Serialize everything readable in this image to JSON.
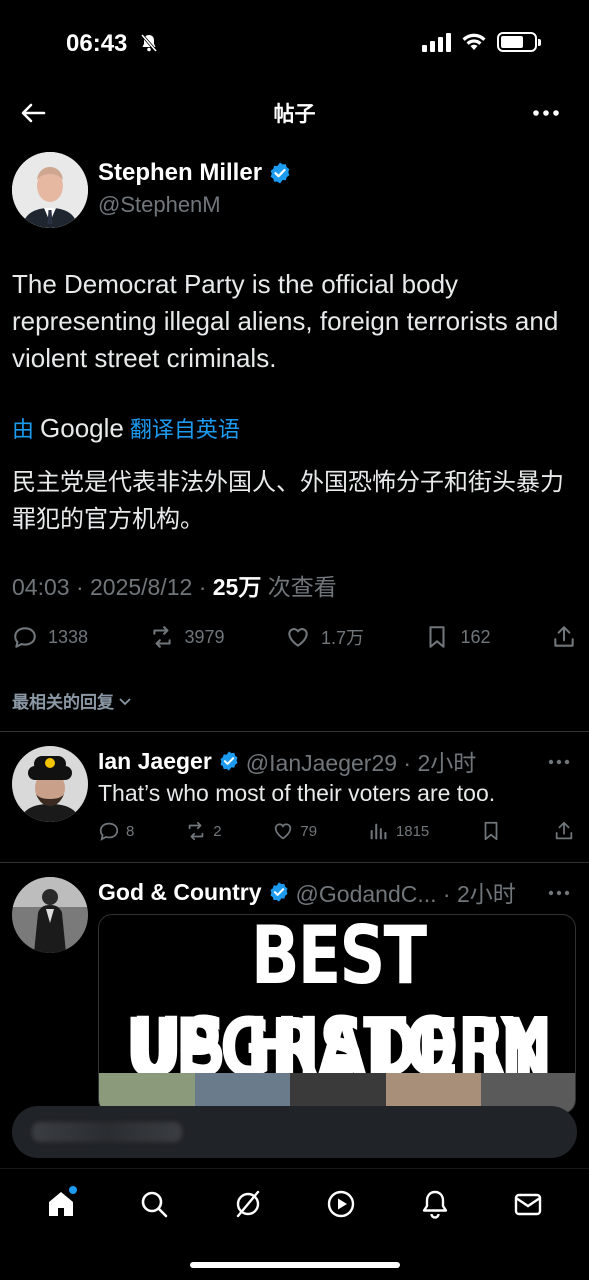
{
  "status": {
    "time": "06:43"
  },
  "nav": {
    "title": "帖子"
  },
  "post": {
    "author_name": "Stephen Miller",
    "author_handle": "@StephenM",
    "text": "The Democrat Party is the official body representing illegal aliens, foreign terrorists and violent street criminals.",
    "translate_prefix": "由",
    "translate_brand": "Google",
    "translate_suffix": "翻译自英语",
    "translated_text": "民主党是代表非法外国人、外国恐怖分子和街头暴力罪犯的官方机构。",
    "time_date": "04:03 · 2025/8/12 · ",
    "views_count": "25万",
    "views_label": " 次查看",
    "replies": "1338",
    "reposts": "3979",
    "likes": "1.7万",
    "bookmarks": "162"
  },
  "sort_label": "最相关的回复",
  "replies": [
    {
      "name": "Ian Jaeger",
      "handle_time": "@IanJaeger29 · 2小时",
      "text": "That’s who most of their voters are too.",
      "replies": "8",
      "reposts": "2",
      "likes": "79",
      "views": "1815"
    },
    {
      "name": "God & Country",
      "handle_time": "@GodandC... · 2小时",
      "media_line1": "BEST UPGRADE IN",
      "media_line2": "US HISTORY"
    }
  ],
  "colors": {
    "accent": "#1d9bf0",
    "background": "#000000",
    "muted": "#71767b"
  },
  "icons": [
    "back-arrow-icon",
    "more-horizontal-icon",
    "verified-badge-icon",
    "reply-icon",
    "repost-icon",
    "like-icon",
    "bookmark-icon",
    "share-icon",
    "views-icon",
    "home-icon",
    "search-icon",
    "grok-icon",
    "video-icon",
    "notifications-icon",
    "messages-icon"
  ]
}
